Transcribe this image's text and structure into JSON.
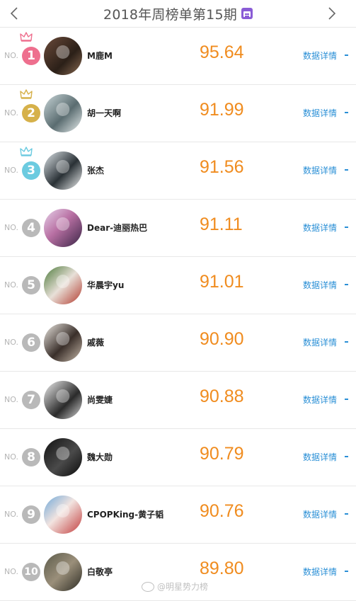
{
  "header": {
    "title": "2018年周榜单第15期",
    "prev_icon": "chevron-left-icon",
    "next_icon": "chevron-right-icon",
    "calendar_icon": "calendar-icon",
    "calendar_color": "#8a5cd6"
  },
  "no_label": "NO.",
  "details_label": "数据详情",
  "colors": {
    "score": "#f08c1f",
    "link": "#2a8fd6",
    "rank1": "#ee6f8e",
    "rank2": "#d6b14a",
    "rank3": "#6ccbe0",
    "rank_other": "#b9b9b9"
  },
  "rankings": [
    {
      "rank": "1",
      "name": "M鹿M",
      "score": "95.64"
    },
    {
      "rank": "2",
      "name": "胡一天啊",
      "score": "91.99"
    },
    {
      "rank": "3",
      "name": "张杰",
      "score": "91.56"
    },
    {
      "rank": "4",
      "name": "Dear-迪丽热巴",
      "score": "91.11"
    },
    {
      "rank": "5",
      "name": "华晨宇yu",
      "score": "91.01"
    },
    {
      "rank": "6",
      "name": "戚薇",
      "score": "90.90"
    },
    {
      "rank": "7",
      "name": "尚雯婕",
      "score": "90.88"
    },
    {
      "rank": "8",
      "name": "魏大勋",
      "score": "90.79"
    },
    {
      "rank": "9",
      "name": "CPOPKing-黄子韬",
      "score": "90.76"
    },
    {
      "rank": "10",
      "name": "白敬亭",
      "score": "89.80"
    }
  ],
  "watermark": "@明星势力榜"
}
